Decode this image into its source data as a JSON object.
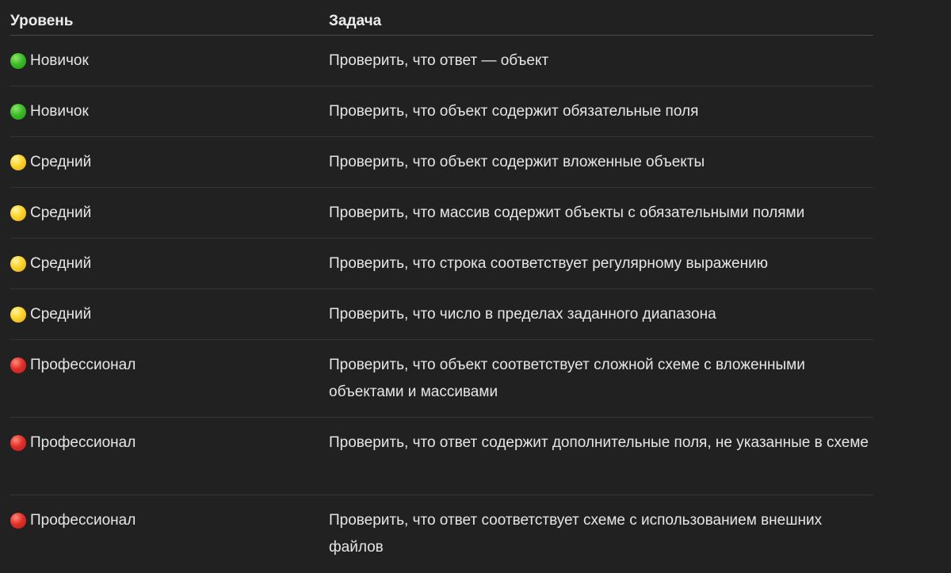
{
  "table": {
    "headers": {
      "level": "Уровень",
      "task": "Задача"
    },
    "rows": [
      {
        "level": "Новичок",
        "dot": "green-circle-icon",
        "task": "Проверить, что ответ — объект"
      },
      {
        "level": "Новичок",
        "dot": "green-circle-icon",
        "task": "Проверить, что объект содержит обязательные поля"
      },
      {
        "level": "Средний",
        "dot": "yellow-circle-icon",
        "task": "Проверить, что объект содержит вложенные объекты"
      },
      {
        "level": "Средний",
        "dot": "yellow-circle-icon",
        "task": "Проверить, что массив содержит объекты с обязательными полями"
      },
      {
        "level": "Средний",
        "dot": "yellow-circle-icon",
        "task": "Проверить, что строка соответствует регулярному выражению"
      },
      {
        "level": "Средний",
        "dot": "yellow-circle-icon",
        "task": "Проверить, что число в пределах заданного диапазона"
      },
      {
        "level": "Профессионал",
        "dot": "red-circle-icon",
        "task": "Проверить, что объект соответствует сложной схеме с вложенными объектами и массивами"
      },
      {
        "level": "Профессионал",
        "dot": "red-circle-icon",
        "task": "Проверить, что ответ содержит дополнительные поля, не указанные в схеме"
      },
      {
        "level": "Профессионал",
        "dot": "red-circle-icon",
        "task": "Проверить, что ответ соответствует схеме с использованием внешних файлов"
      }
    ]
  },
  "colors": {
    "background": "#212121",
    "text": "#e6e6e6",
    "green": "#3dbb29",
    "yellow": "#fbd32c",
    "red": "#e2302a"
  }
}
